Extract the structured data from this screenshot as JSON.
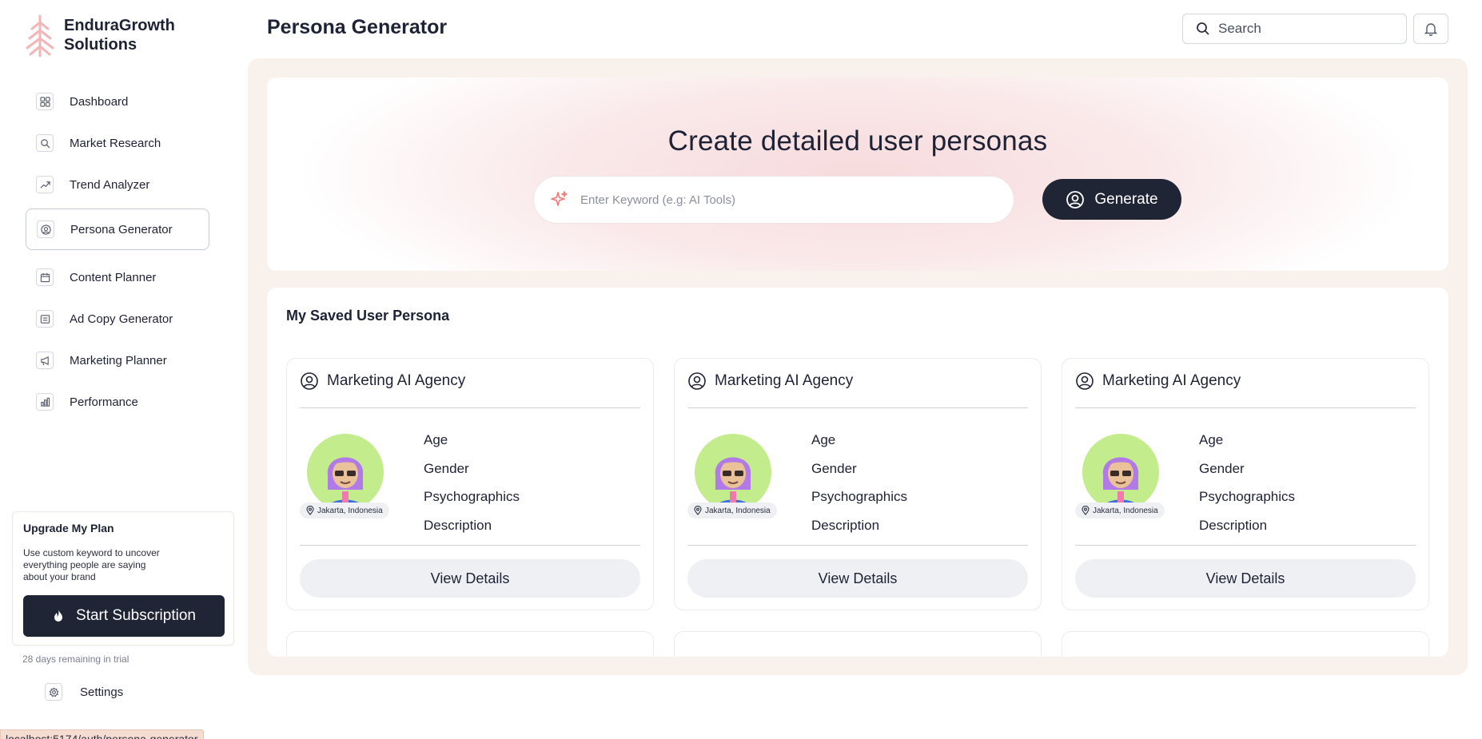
{
  "brand": {
    "name": "EnduraGrowth Solutions",
    "accent": "#f2b6b6"
  },
  "sidebar": {
    "items": [
      {
        "label": "Dashboard",
        "icon": "grid-icon"
      },
      {
        "label": "Market Research",
        "icon": "search-icon"
      },
      {
        "label": "Trend Analyzer",
        "icon": "trend-icon"
      },
      {
        "label": "Persona Generator",
        "icon": "user-circle-icon",
        "active": true
      },
      {
        "label": "Content Planner",
        "icon": "calendar-icon"
      },
      {
        "label": "Ad Copy Generator",
        "icon": "ad-icon"
      },
      {
        "label": "Marketing Planner",
        "icon": "megaphone-icon"
      },
      {
        "label": "Performance",
        "icon": "bar-chart-icon"
      }
    ],
    "upgrade": {
      "title": "Upgrade My Plan",
      "description": "Use custom keyword to uncover everything people are saying about your brand",
      "button": "Start Subscription"
    },
    "trial_text": "28 days remaining in trial",
    "settings_label": "Settings"
  },
  "header": {
    "title": "Persona Generator",
    "search_placeholder": "Search"
  },
  "hero": {
    "title": "Create detailed user personas",
    "keyword_placeholder": "Enter Keyword (e.g: AI Tools)",
    "generate_label": "Generate"
  },
  "saved": {
    "title": "My Saved User Persona",
    "cards": [
      {
        "name": "Marketing AI Agency",
        "location": "Jakarta, Indonesia",
        "fields": [
          "Age",
          "Gender",
          "Psychographics",
          "Description"
        ],
        "button": "View Details"
      },
      {
        "name": "Marketing AI Agency",
        "location": "Jakarta, Indonesia",
        "fields": [
          "Age",
          "Gender",
          "Psychographics",
          "Description"
        ],
        "button": "View Details"
      },
      {
        "name": "Marketing AI Agency",
        "location": "Jakarta, Indonesia",
        "fields": [
          "Age",
          "Gender",
          "Psychographics",
          "Description"
        ],
        "button": "View Details"
      }
    ]
  },
  "status_url": "localhost:5174/auth/persona-generator"
}
